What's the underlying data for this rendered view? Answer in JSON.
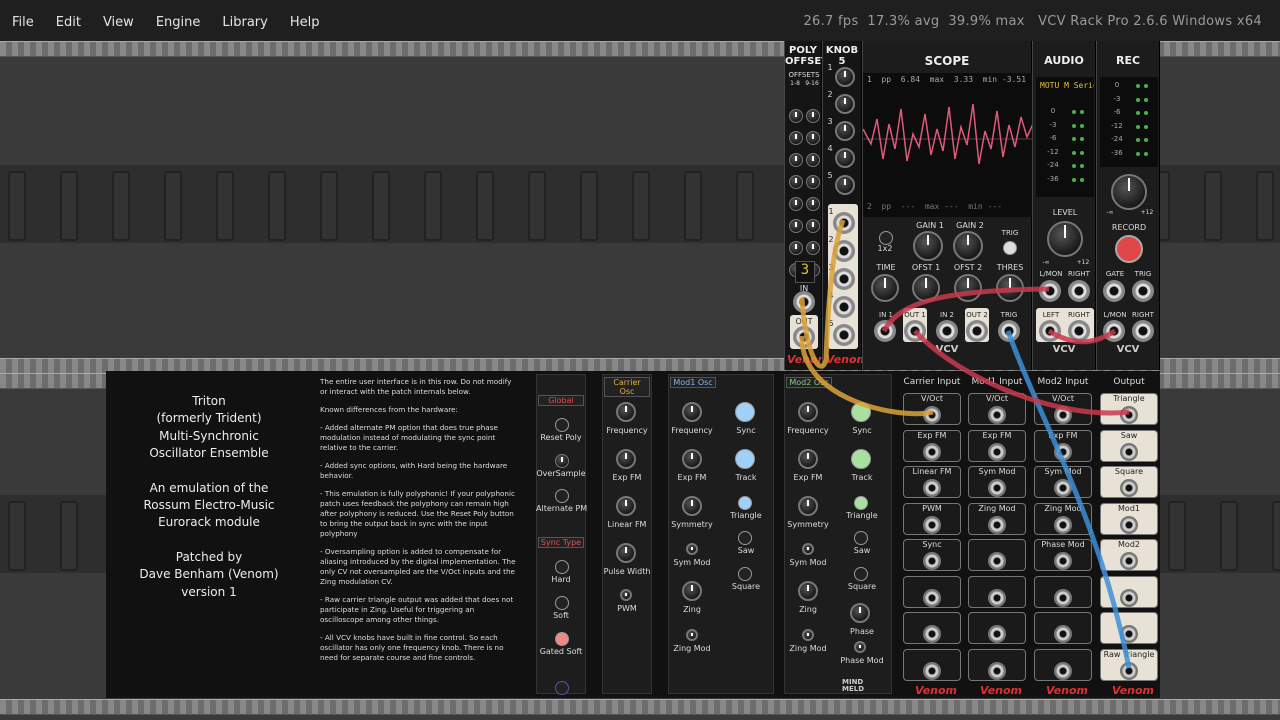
{
  "menu": {
    "items": [
      "File",
      "Edit",
      "View",
      "Engine",
      "Library",
      "Help"
    ]
  },
  "status": {
    "fps": "26.7 fps",
    "avg": "17.3% avg",
    "max": "39.9% max",
    "app": "VCV Rack Pro 2.6.6 Windows x64"
  },
  "poly_offset": {
    "title": "POLY OFFSET",
    "offsets_label": "OFFSETS",
    "range_a": "1-8",
    "range_b": "9-16",
    "display": "3",
    "in_label": "IN",
    "out_label": "OUT",
    "brand": "Venom"
  },
  "knob5": {
    "title": "KNOB 5",
    "numbers": [
      "1",
      "2",
      "3",
      "4",
      "5"
    ],
    "brand": "Venom"
  },
  "scope": {
    "title": "SCOPE",
    "row1": {
      "ch": "1",
      "pp": "pp",
      "ppv": "6.84",
      "max": "max",
      "maxv": "3.33",
      "min": "min",
      "minv": "-3.51"
    },
    "row2": {
      "ch": "2",
      "pp": "pp",
      "ppv": "---",
      "max": "max",
      "maxv": "---",
      "min": "min",
      "minv": "---"
    },
    "x2": "1x2",
    "gain1": "GAIN 1",
    "gain2": "GAIN 2",
    "trig": "TRIG",
    "time": "TIME",
    "ofst1": "OFST 1",
    "ofst2": "OFST 2",
    "thres": "THRES",
    "in1": "IN 1",
    "out1": "OUT 1",
    "in2": "IN 2",
    "out2": "OUT 2",
    "trig2": "TRIG",
    "brand": "VCV",
    "trace_color": "#e05a78"
  },
  "audio": {
    "title": "AUDIO",
    "device": "MOTU M Series",
    "db": [
      "0",
      "-3",
      "-6",
      "-12",
      "-24",
      "-36"
    ],
    "level": "LEVEL",
    "lmon": "L/MON",
    "right": "RIGHT",
    "left": "LEFT",
    "right2": "RIGHT",
    "brand": "VCV",
    "min": "-∞",
    "max": "+12"
  },
  "rec": {
    "title": "REC",
    "db": [
      "0",
      "-3",
      "-6",
      "-12",
      "-24",
      "-36"
    ],
    "record": "RECORD",
    "gate": "GATE",
    "trig": "TRIG",
    "lmon": "L/MON",
    "right": "RIGHT",
    "brand": "VCV",
    "min": "-∞",
    "max": "+12"
  },
  "triton": {
    "desc": [
      "Triton",
      "(formerly Trident)",
      "Multi-Synchronic",
      "Oscillator Ensemble",
      "",
      "An emulation of the",
      "Rossum Electro-Music",
      "Eurorack module",
      "",
      "Patched by",
      "Dave Benham (Venom)",
      "version 1"
    ],
    "notes": [
      "The entire user interface is in this row. Do not modify or interact with the patch internals below.",
      "Known differences from the hardware:",
      "- Added alternate PM option that does true phase modulation instead of modulating the sync point relative to the carrier.",
      "- Added sync options, with Hard being the hardware behavior.",
      "- This emulation is fully polyphonic! If your polyphonic patch uses feedback the polyphony can remain high after polyphony is reduced. Use the Reset Poly button to bring the output back in sync with the input polyphony",
      "- Oversampling option is added to compensate for aliasing introduced by the digital implementation. The only CV not oversampled are the V/Oct inputs and the Zing modulation CV.",
      "- Raw carrier triangle output was added that does not participate in Zing. Useful for triggering an oscilloscope among other things.",
      "- All VCV knobs have built in fine control. So each oscillator has only one frequency knob. There is no need for separate course and fine controls."
    ],
    "global": {
      "header": "Global",
      "items": [
        "Reset Poly",
        "OverSample",
        "Alternate PM"
      ]
    },
    "sync_type": {
      "header": "Sync Type",
      "items": [
        "Hard",
        "Soft",
        "Gated Soft"
      ]
    },
    "carrier": {
      "header": "Carrier Osc",
      "items": [
        "Frequency",
        "Exp FM",
        "Linear FM",
        "Pulse Width",
        "PWM"
      ]
    },
    "mod1": {
      "header": "Mod1 Osc",
      "knobs": [
        "Frequency",
        "Exp FM",
        "Symmetry",
        "Sym Mod",
        "Zing",
        "Zing Mod"
      ],
      "buttons": [
        "Sync",
        "Track",
        "Triangle",
        "Saw",
        "Square"
      ]
    },
    "mod2": {
      "header": "Mod2 Osc",
      "knobs": [
        "Frequency",
        "Exp FM",
        "Symmetry",
        "Sym Mod",
        "Zing",
        "Zing Mod"
      ],
      "buttons": [
        "Sync",
        "Track",
        "Triangle",
        "Saw",
        "Square",
        "Phase",
        "Phase Mod"
      ]
    },
    "io_headers": [
      "Carrier Input",
      "Mod1 Input",
      "Mod2 Input",
      "Output"
    ],
    "carrier_in": [
      "V/Oct",
      "Exp FM",
      "Linear FM",
      "PWM",
      "Sync",
      "",
      "",
      ""
    ],
    "mod1_in": [
      "V/Oct",
      "Exp FM",
      "Sym Mod",
      "Zing Mod",
      "",
      "",
      "",
      ""
    ],
    "mod2_in": [
      "V/Oct",
      "Exp FM",
      "Sym Mod",
      "Zing Mod",
      "Phase Mod",
      "",
      "",
      ""
    ],
    "outputs": [
      "Triangle",
      "Saw",
      "Square",
      "Mod1",
      "Mod2",
      "",
      "",
      "Raw Triangle"
    ],
    "mindmeld": "MIND MELD",
    "brand": "Venom"
  },
  "cables": {
    "yellow": "#d9a23a",
    "blue": "#3d8fd6",
    "red": "#c9384e"
  }
}
